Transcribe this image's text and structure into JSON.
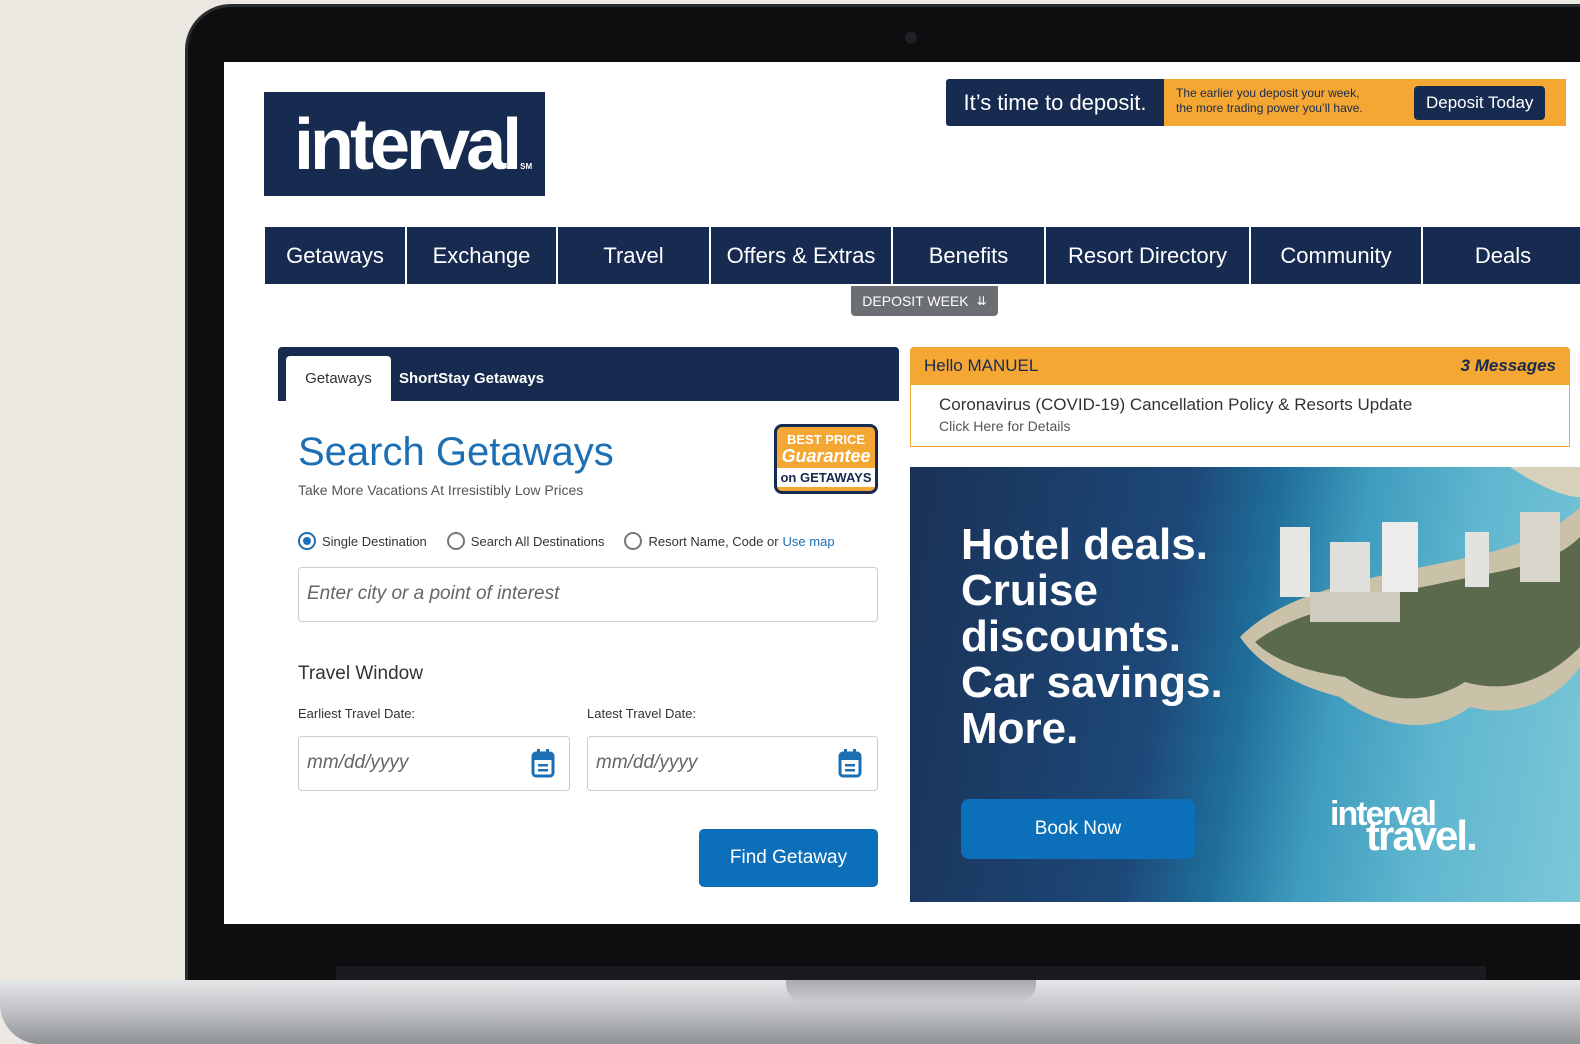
{
  "header": {
    "logo_text": "interval",
    "logo_mark": "SM"
  },
  "deposit_banner": {
    "title": "It’s time to deposit.",
    "subtitle_line1": "The earlier you deposit your week,",
    "subtitle_line2": "the more trading power you’ll have.",
    "button_label": "Deposit Today"
  },
  "nav": {
    "items": [
      {
        "label": "Getaways"
      },
      {
        "label": "Exchange"
      },
      {
        "label": "Travel"
      },
      {
        "label": "Offers & Extras"
      },
      {
        "label": "Benefits"
      },
      {
        "label": "Resort Directory"
      },
      {
        "label": "Community"
      },
      {
        "label": "Deals"
      }
    ],
    "deposit_week_label": "DEPOSIT WEEK"
  },
  "search": {
    "tabs": [
      {
        "label": "Getaways",
        "active": true
      },
      {
        "label": "ShortStay Getaways",
        "active": false
      }
    ],
    "title": "Search Getaways",
    "subtitle": "Take More Vacations At Irresistibly Low Prices",
    "badge": {
      "line1": "BEST PRICE",
      "line2": "Guarantee",
      "line3": "on GETAWAYS"
    },
    "radio_options": [
      {
        "label": "Single Destination",
        "selected": true
      },
      {
        "label": "Search All Destinations",
        "selected": false
      },
      {
        "label": "Resort Name, Code or",
        "selected": false
      }
    ],
    "use_map_link": "Use map",
    "city_placeholder": "Enter city or a point of interest",
    "travel_window_label": "Travel Window",
    "earliest_label": "Earliest Travel Date:",
    "latest_label": "Latest Travel Date:",
    "date_placeholder": "mm/dd/yyyy",
    "submit_label": "Find Getaway"
  },
  "greeting": {
    "hello": "Hello MANUEL",
    "messages": "3 Messages",
    "notice_title": "Coronavirus (COVID-19) Cancellation Policy & Resorts Update",
    "notice_link": "Click Here for Details"
  },
  "hero": {
    "lines": [
      "Hotel deals.",
      "Cruise",
      "discounts.",
      "Car savings.",
      "More."
    ],
    "button_label": "Book Now",
    "brand_top": "interval",
    "brand_bottom": "travel."
  },
  "colors": {
    "navy": "#172a4f",
    "orange": "#f5a733",
    "blue": "#0c6fba"
  }
}
